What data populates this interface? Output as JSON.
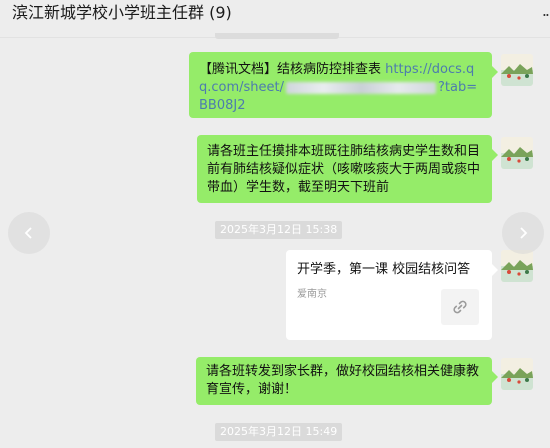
{
  "header": {
    "title": "滨江新城学校小学班主任群 (9)",
    "more_label": ".."
  },
  "messages": {
    "msg1": {
      "prefix": "【腾讯文档】结核病防控排查表 ",
      "link_start": "https://docs.qq.com/sheet/",
      "link_end": "?tab=BB08J2"
    },
    "msg2": {
      "text": "请各班主任摸排本班既往肺结核病史学生数和目前有肺结核疑似症状（咳嗽咳痰大于两周或痰中带血）学生数，截至明天下班前"
    },
    "time1": "2025年3月12日 15:38",
    "card": {
      "title": "开学季，第一课 校园结核问答",
      "source": "爱南京"
    },
    "msg3": {
      "text": "请各班转发到家长群，做好校园结核相关健康教育宣传，谢谢！"
    },
    "time2": "2025年3月12日 15:49"
  },
  "colors": {
    "bubble_green": "#95ec69",
    "background": "#ededed",
    "link": "#4d7cae"
  },
  "icons": {
    "card_icon": "link-icon",
    "nav_left": "chevron-left-icon",
    "nav_right": "chevron-right-icon",
    "avatar": "avatar-landscape"
  }
}
